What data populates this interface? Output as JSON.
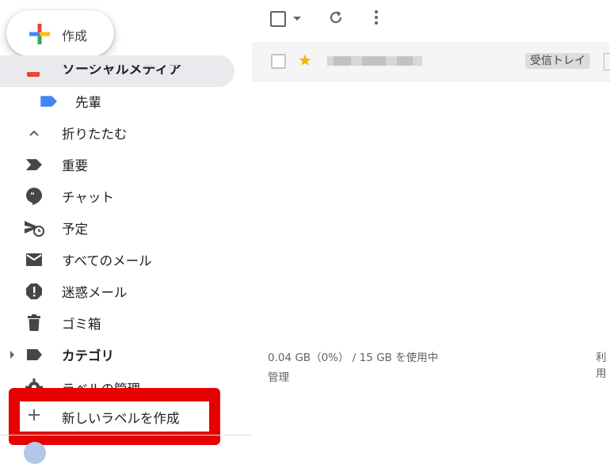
{
  "compose": {
    "label": "作成"
  },
  "sidebar": {
    "clipped_label": "ソーシャルメディア",
    "items": [
      {
        "label": "先輩",
        "icon": "label-blue-icon",
        "color": "#4285f4"
      },
      {
        "label": "折りたたむ",
        "icon": "chevron-up-icon"
      },
      {
        "label": "重要",
        "icon": "important-icon"
      },
      {
        "label": "チャット",
        "icon": "chat-icon"
      },
      {
        "label": "予定",
        "icon": "scheduled-icon"
      },
      {
        "label": "すべてのメール",
        "icon": "mail-icon"
      },
      {
        "label": "迷惑メール",
        "icon": "spam-icon"
      },
      {
        "label": "ゴミ箱",
        "icon": "trash-icon"
      },
      {
        "label": "カテゴリ",
        "icon": "label-icon"
      },
      {
        "label": "ラベルの管理",
        "icon": "gear-icon"
      },
      {
        "label": "新しいラベルを作成",
        "icon": "plus-icon"
      }
    ]
  },
  "email_list": {
    "rows": [
      {
        "badge": "受信トレイ",
        "starred": true
      }
    ]
  },
  "footer": {
    "storage": "0.04 GB（0%） / 15 GB を使用中",
    "manage": "管理",
    "right_clip": "利用"
  },
  "colors": {
    "highlight": "#e60000",
    "star": "#f4b400",
    "accent_blue": "#4285f4"
  }
}
